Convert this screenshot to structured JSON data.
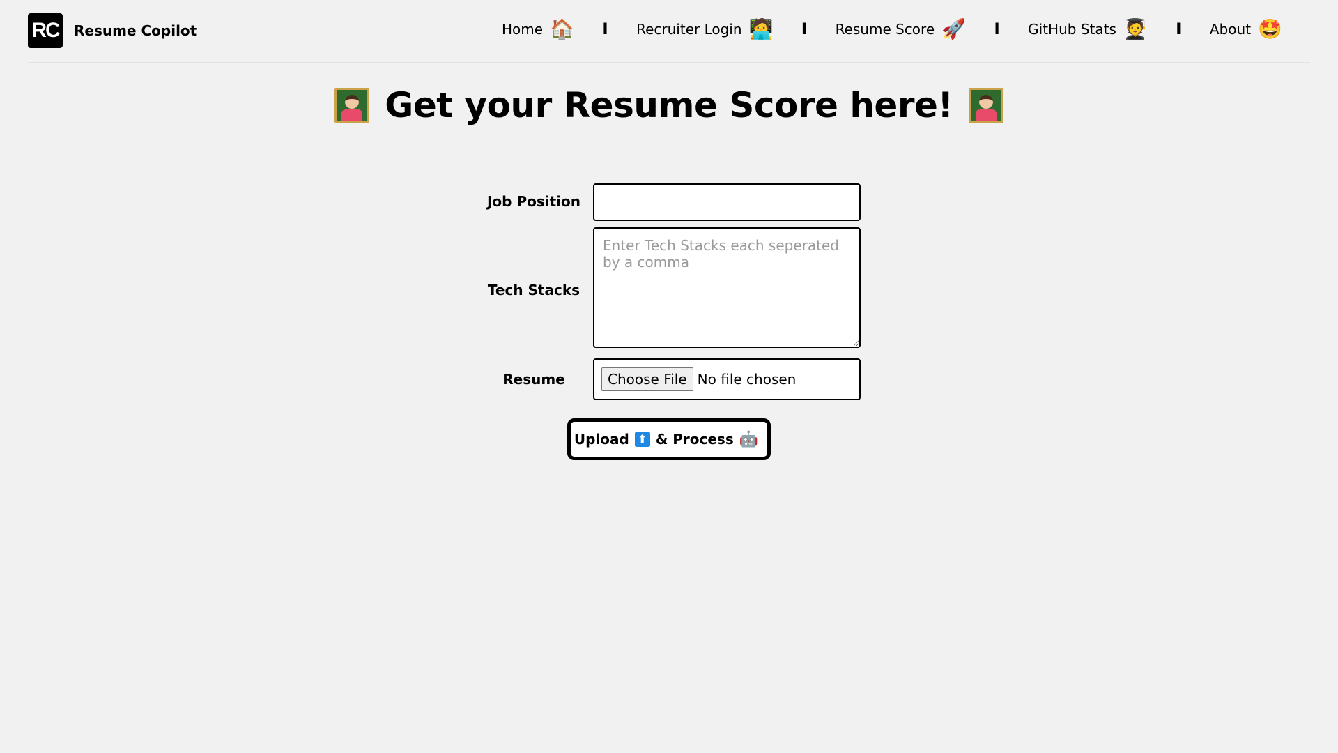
{
  "brand": {
    "logo_text": "RC",
    "name": "Resume Copilot"
  },
  "nav": {
    "items": [
      {
        "label": "Home",
        "icon": "🏠"
      },
      {
        "label": "Recruiter Login",
        "icon": "🧑‍💻"
      },
      {
        "label": "Resume Score",
        "icon": "🚀"
      },
      {
        "label": "GitHub Stats",
        "icon": "🧑‍🎓"
      },
      {
        "label": "About",
        "icon": "🤩"
      }
    ],
    "separator": "I"
  },
  "heading": {
    "title": "Get your Resume Score here!"
  },
  "form": {
    "job_label": "Job Position",
    "job_value": "",
    "tech_label": "Tech Stacks",
    "tech_placeholder": "Enter Tech Stacks each seperated by a comma",
    "resume_label": "Resume",
    "choose_file": "Choose File",
    "file_status": "No file chosen",
    "submit_upload": "Upload",
    "submit_upload_icon": "⬆",
    "submit_process": "& Process",
    "submit_process_icon": "🤖"
  }
}
